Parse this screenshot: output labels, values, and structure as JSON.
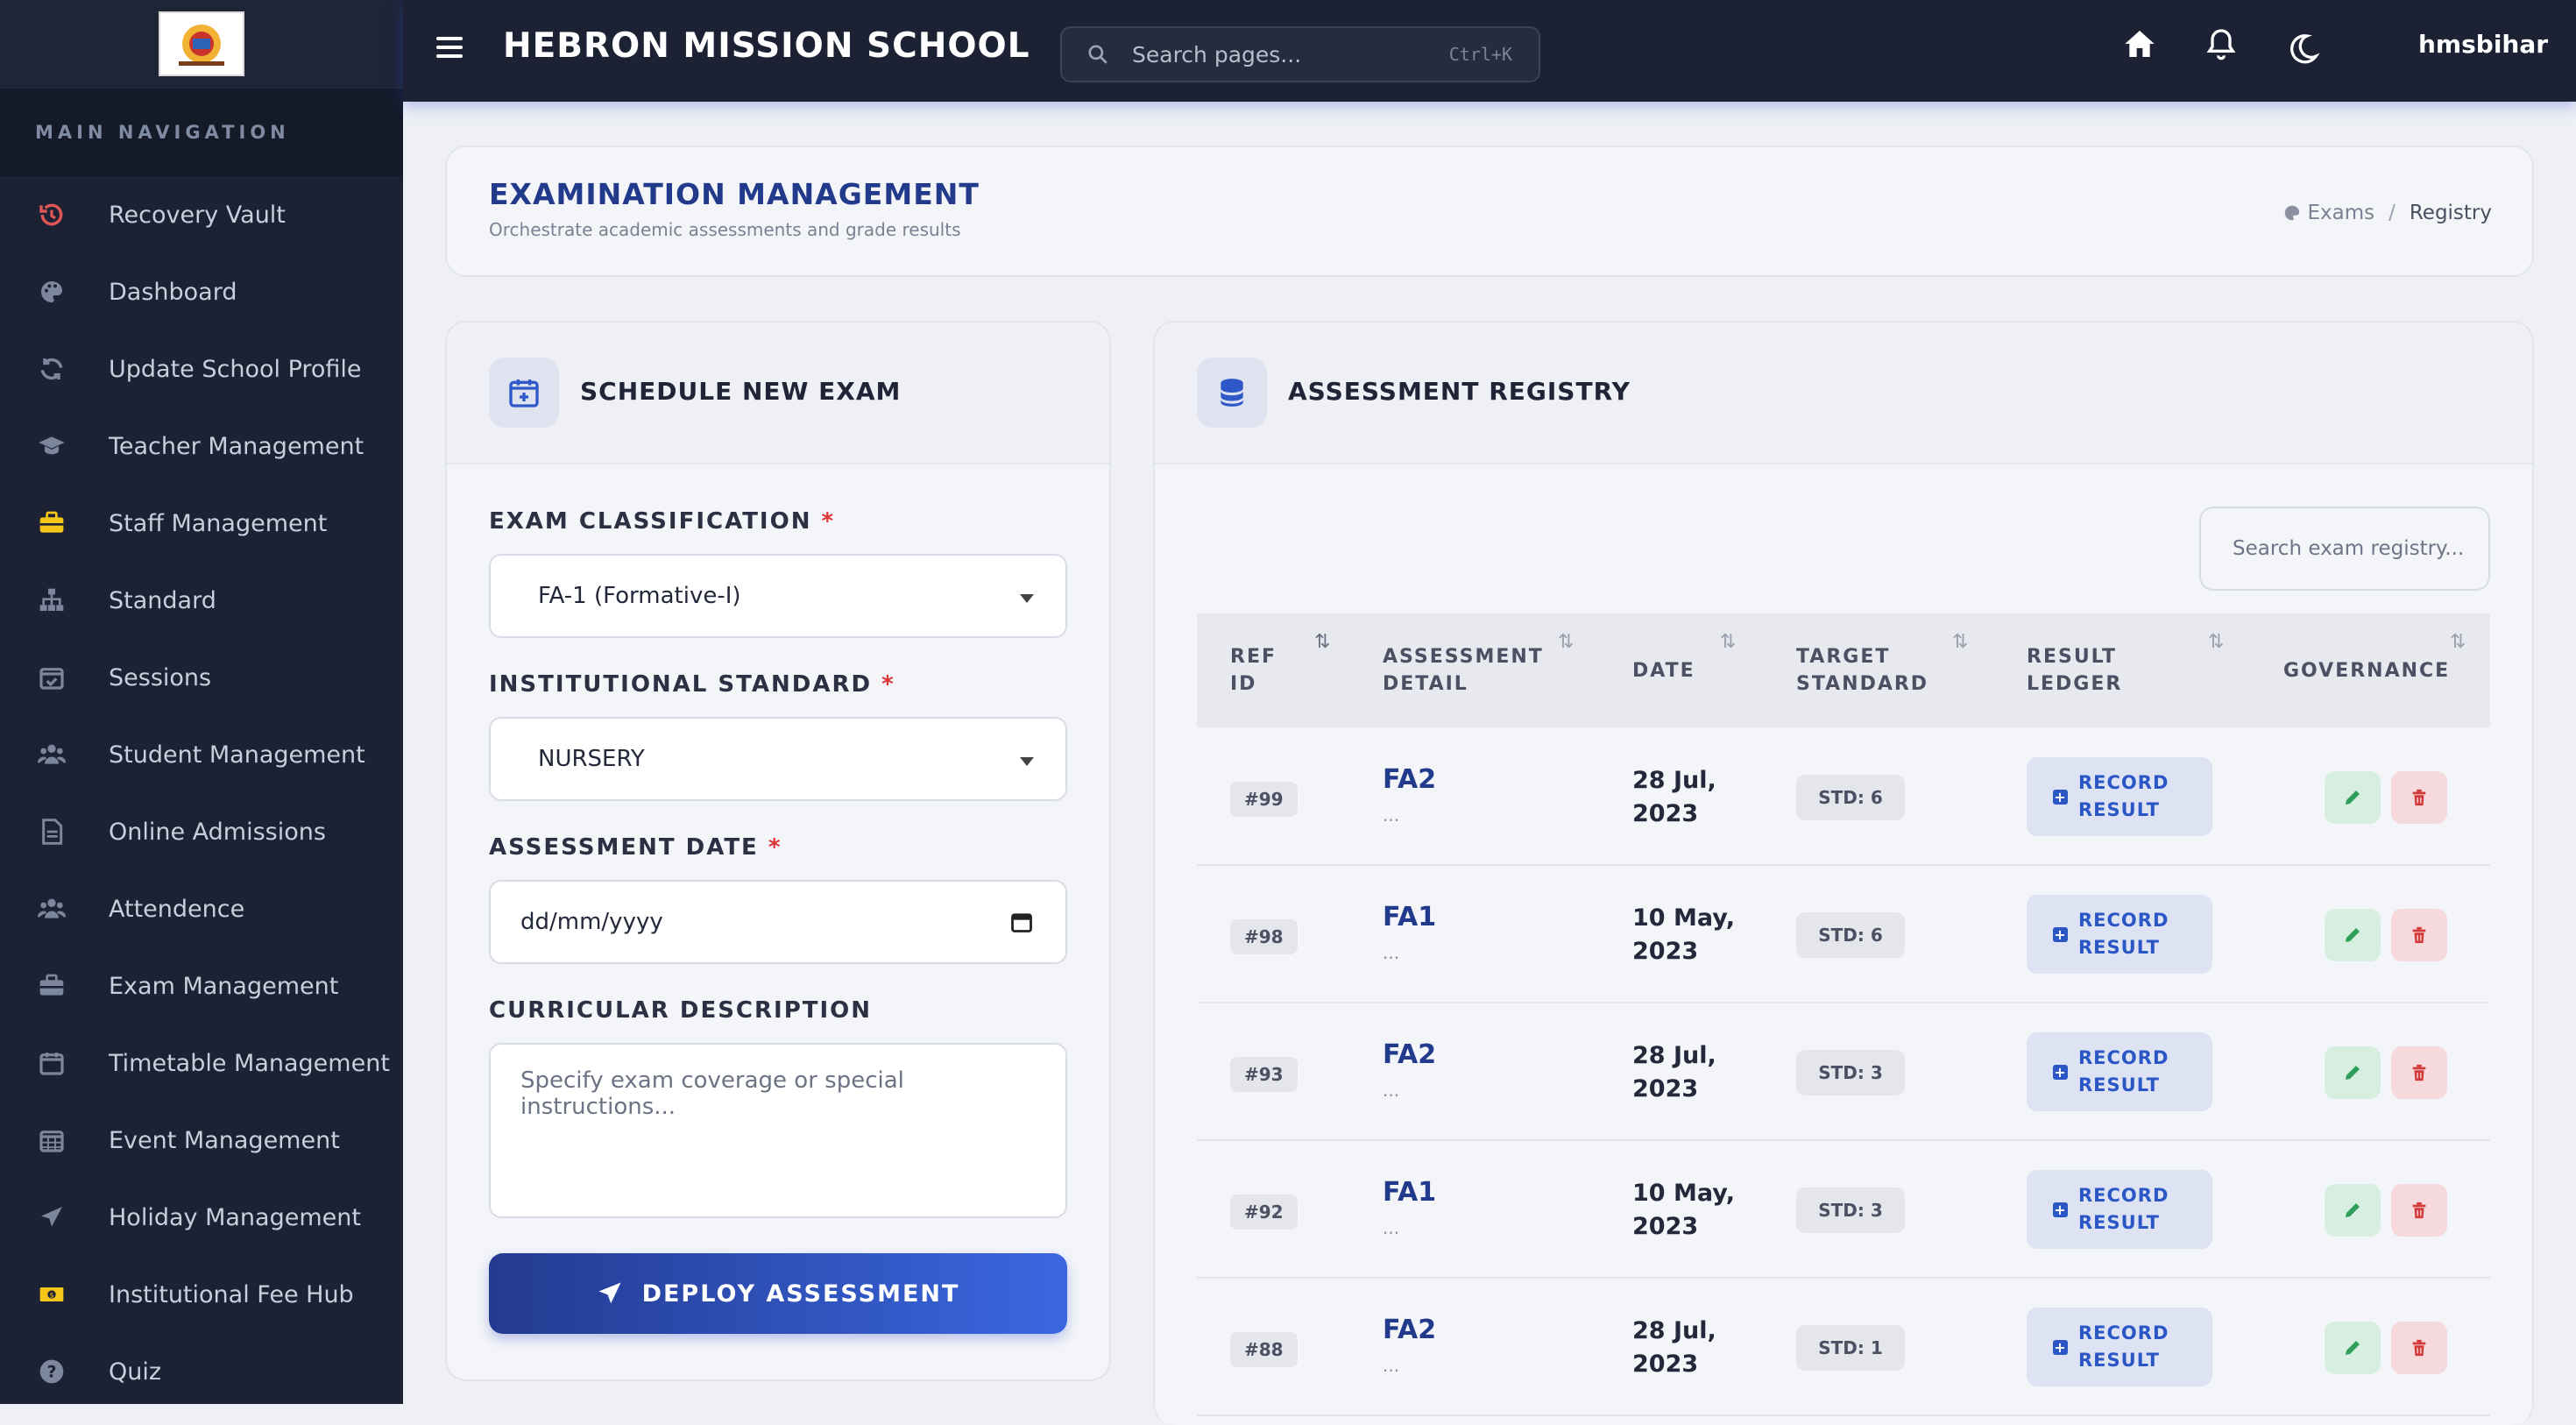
{
  "topbar": {
    "brand": "HEBRON MISSION SCHOOL",
    "search_placeholder": "Search pages...",
    "search_shortcut": "Ctrl+K",
    "username": "hmsbihar"
  },
  "sidebar": {
    "heading": "MAIN NAVIGATION",
    "items": [
      {
        "label": "Recovery Vault",
        "icon": "history-icon",
        "color": "#e05656"
      },
      {
        "label": "Dashboard",
        "icon": "palette-icon",
        "color": "#7c869c"
      },
      {
        "label": "Update School Profile",
        "icon": "refresh-icon",
        "color": "#7c869c"
      },
      {
        "label": "Teacher Management",
        "icon": "graduation-cap-icon",
        "color": "#7c869c"
      },
      {
        "label": "Staff Management",
        "icon": "briefcase-icon",
        "color": "#f5c518"
      },
      {
        "label": "Standard",
        "icon": "sitemap-icon",
        "color": "#7c869c"
      },
      {
        "label": "Sessions",
        "icon": "calendar-check-icon",
        "color": "#7c869c"
      },
      {
        "label": "Student Management",
        "icon": "users-icon",
        "color": "#7c869c"
      },
      {
        "label": "Online Admissions",
        "icon": "document-icon",
        "color": "#7c869c"
      },
      {
        "label": "Attendence",
        "icon": "users-icon",
        "color": "#7c869c"
      },
      {
        "label": "Exam Management",
        "icon": "briefcase-icon",
        "color": "#7c869c"
      },
      {
        "label": "Timetable Management",
        "icon": "calendar-icon",
        "color": "#7c869c"
      },
      {
        "label": "Event Management",
        "icon": "calendar-grid-icon",
        "color": "#7c869c"
      },
      {
        "label": "Holiday Management",
        "icon": "plane-icon",
        "color": "#7c869c"
      },
      {
        "label": "Institutional Fee Hub",
        "icon": "money-icon",
        "color": "#f5c518"
      },
      {
        "label": "Quiz",
        "icon": "question-circle-icon",
        "color": "#7c869c"
      }
    ]
  },
  "page": {
    "title": "EXAMINATION MANAGEMENT",
    "subtitle": "Orchestrate academic assessments and grade results",
    "breadcrumb": {
      "root": "Exams",
      "separator": "/",
      "current": "Registry"
    }
  },
  "form": {
    "title": "SCHEDULE NEW EXAM",
    "classification_label": "EXAM CLASSIFICATION",
    "classification_value": "FA-1 (Formative-I)",
    "standard_label": "INSTITUTIONAL STANDARD",
    "standard_value": "NURSERY",
    "date_label": "ASSESSMENT DATE",
    "date_placeholder": "dd/mm/yyyy",
    "description_label": "CURRICULAR DESCRIPTION",
    "description_placeholder": "Specify exam coverage or special instructions...",
    "required_mark": "*",
    "submit_label": "DEPLOY ASSESSMENT"
  },
  "registry": {
    "title": "ASSESSMENT REGISTRY",
    "search_placeholder": "Search exam registry...",
    "columns": {
      "ref_1": "REF",
      "ref_2": "ID",
      "detail_1": "ASSESSMENT",
      "detail_2": "DETAIL",
      "date": "DATE",
      "target_1": "TARGET",
      "target_2": "STANDARD",
      "ledger_1": "RESULT",
      "ledger_2": "LEDGER",
      "governance": "GOVERNANCE"
    },
    "record_label_1": "RECORD",
    "record_label_2": "RESULT",
    "rows": [
      {
        "ref": "#99",
        "name": "FA2",
        "desc": "...",
        "date_1": "28 Jul,",
        "date_2": "2023",
        "std": "STD: 6"
      },
      {
        "ref": "#98",
        "name": "FA1",
        "desc": "...",
        "date_1": "10 May,",
        "date_2": "2023",
        "std": "STD: 6"
      },
      {
        "ref": "#93",
        "name": "FA2",
        "desc": "...",
        "date_1": "28 Jul,",
        "date_2": "2023",
        "std": "STD: 3"
      },
      {
        "ref": "#92",
        "name": "FA1",
        "desc": "...",
        "date_1": "10 May,",
        "date_2": "2023",
        "std": "STD: 3"
      },
      {
        "ref": "#88",
        "name": "FA2",
        "desc": "...",
        "date_1": "28 Jul,",
        "date_2": "2023",
        "std": "STD: 1"
      }
    ]
  },
  "colors": {
    "accent": "#213a8c",
    "sidebar_bg": "#1c2233",
    "danger": "#d33b3b",
    "success": "#2f9e5a"
  }
}
